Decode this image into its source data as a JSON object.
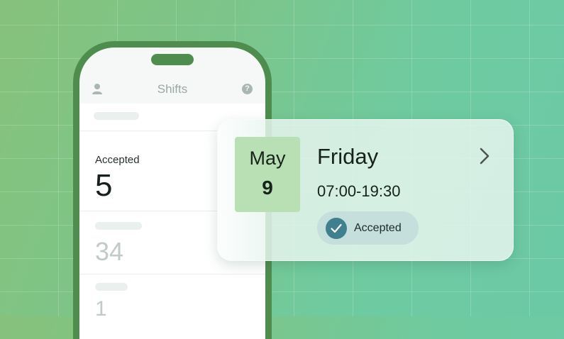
{
  "phone": {
    "header_title": "Shifts",
    "help_symbol": "?",
    "user_icon": "user-icon",
    "help_icon": "help-circle-icon",
    "accepted_label": "Accepted",
    "accepted_count": "5",
    "second_count": "34",
    "third_count": "1"
  },
  "card": {
    "month": "May",
    "day": "9",
    "weekday": "Friday",
    "time_range": "07:00-19:30",
    "status": "Accepted",
    "status_icon": "check-icon",
    "arrow_icon": "chevron-right-icon"
  },
  "colors": {
    "phone_frame": "#4f8d4e",
    "date_box": "#b9e0b4",
    "status_badge": "#c4dfdc",
    "status_check": "#3f7f8e"
  }
}
